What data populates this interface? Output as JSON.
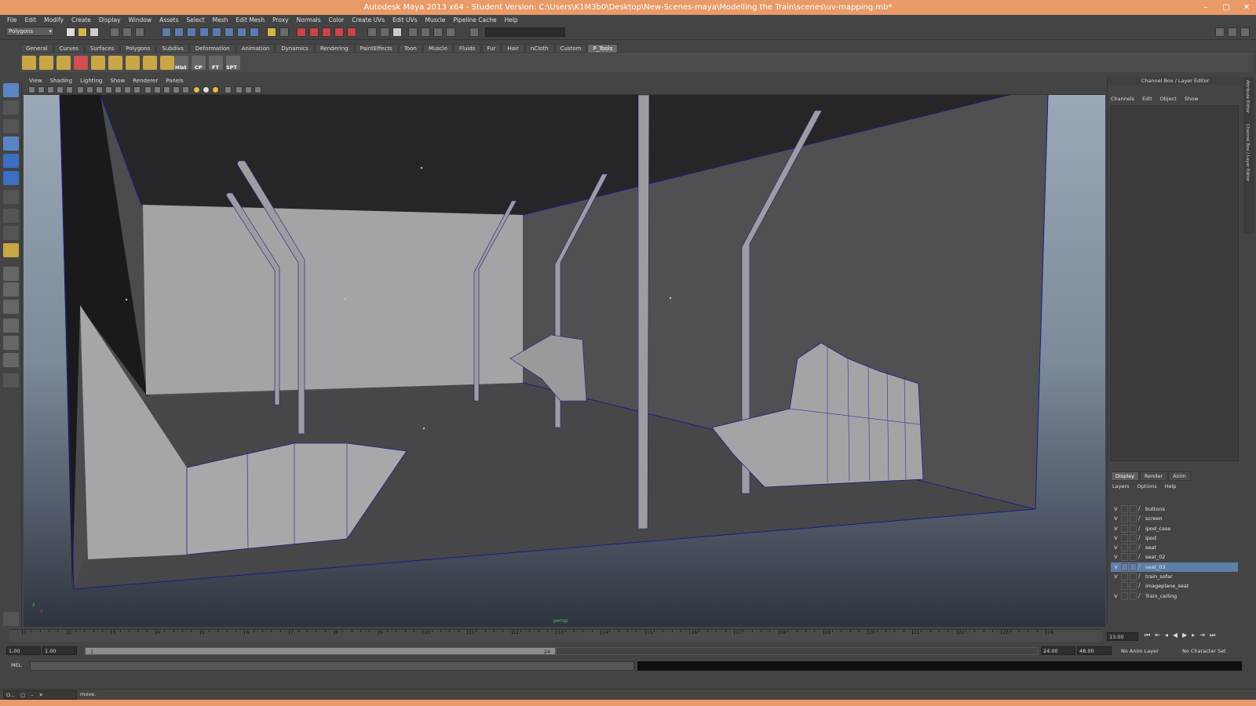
{
  "window": {
    "title": "Autodesk Maya 2013 x64 - Student Version: C:\\Users\\K1M3b0\\Desktop\\New-Scenes-maya\\Modelling the Train\\scenes\\uv-mapping.mb*",
    "controls": [
      "–",
      "▢",
      "✕"
    ]
  },
  "menubar": [
    "File",
    "Edit",
    "Modify",
    "Create",
    "Display",
    "Window",
    "Assets",
    "Select",
    "Mesh",
    "Edit Mesh",
    "Proxy",
    "Normals",
    "Color",
    "Create UVs",
    "Edit UVs",
    "Muscle",
    "Pipeline Cache",
    "Help"
  ],
  "statusline": {
    "mode": "Polygons"
  },
  "shelf": {
    "tabs": [
      "General",
      "Curves",
      "Surfaces",
      "Polygons",
      "Subdivs",
      "Deformation",
      "Animation",
      "Dynamics",
      "Rendering",
      "PaintEffects",
      "Toon",
      "Muscle",
      "Fluids",
      "Fur",
      "Hair",
      "nCloth",
      "Custom",
      "P_Tools"
    ],
    "active_tab": "P_Tools",
    "labels": [
      "Hist",
      "CP",
      "FT",
      "SPT"
    ]
  },
  "viewport": {
    "menu": [
      "View",
      "Shading",
      "Lighting",
      "Show",
      "Renderer",
      "Panels"
    ],
    "camera": "persp",
    "axis_x": "x",
    "axis_y": "y"
  },
  "channel_box": {
    "title": "Channel Box / Layer Editor",
    "menu": [
      "Channels",
      "Edit",
      "Object",
      "Show"
    ]
  },
  "side_tabs": [
    "Attribute Editor",
    "Channel Box / Layer Editor"
  ],
  "layer_editor": {
    "tabs": [
      "Display",
      "Render",
      "Anim"
    ],
    "active_tab": "Display",
    "menu": [
      "Layers",
      "Options",
      "Help"
    ],
    "layers": [
      {
        "v": "V",
        "name": "buttons"
      },
      {
        "v": "V",
        "name": "screen"
      },
      {
        "v": "V",
        "name": "ipod_case"
      },
      {
        "v": "V",
        "name": "ipod"
      },
      {
        "v": "V",
        "name": "seat"
      },
      {
        "v": "V",
        "name": "seat_02"
      },
      {
        "v": "V",
        "name": "seat_03"
      },
      {
        "v": "V",
        "name": "train_sofar"
      },
      {
        "v": "",
        "name": "imageplane_seat"
      },
      {
        "v": "V",
        "name": "Train_ceiling"
      }
    ],
    "selected_index": 6
  },
  "time_slider": {
    "ticks": [
      "1",
      "2",
      "3",
      "4",
      "5",
      "6",
      "7",
      "8",
      "9",
      "10",
      "11",
      "12",
      "13",
      "14",
      "15",
      "16",
      "17",
      "18",
      "19",
      "20",
      "21",
      "22",
      "23",
      "24"
    ],
    "current_frame": "13.00"
  },
  "range_slider": {
    "start": "1.00",
    "playback_start": "1.00",
    "range_start_label": "1",
    "range_end_label": "24",
    "playback_end": "24.00",
    "end": "48.00",
    "anim_layer": "No Anim Layer",
    "character_set": "No Character Set"
  },
  "command_line": {
    "label": "MEL"
  },
  "help_line": {
    "text": "move.",
    "minimized_label": "O..."
  },
  "colors": {
    "titlebar": "#e89a68",
    "ui_bg": "#444444",
    "layer_selected": "#5d7fa8",
    "mesh_face": "#a6a6a6",
    "wireframe": "#1b1b86"
  }
}
